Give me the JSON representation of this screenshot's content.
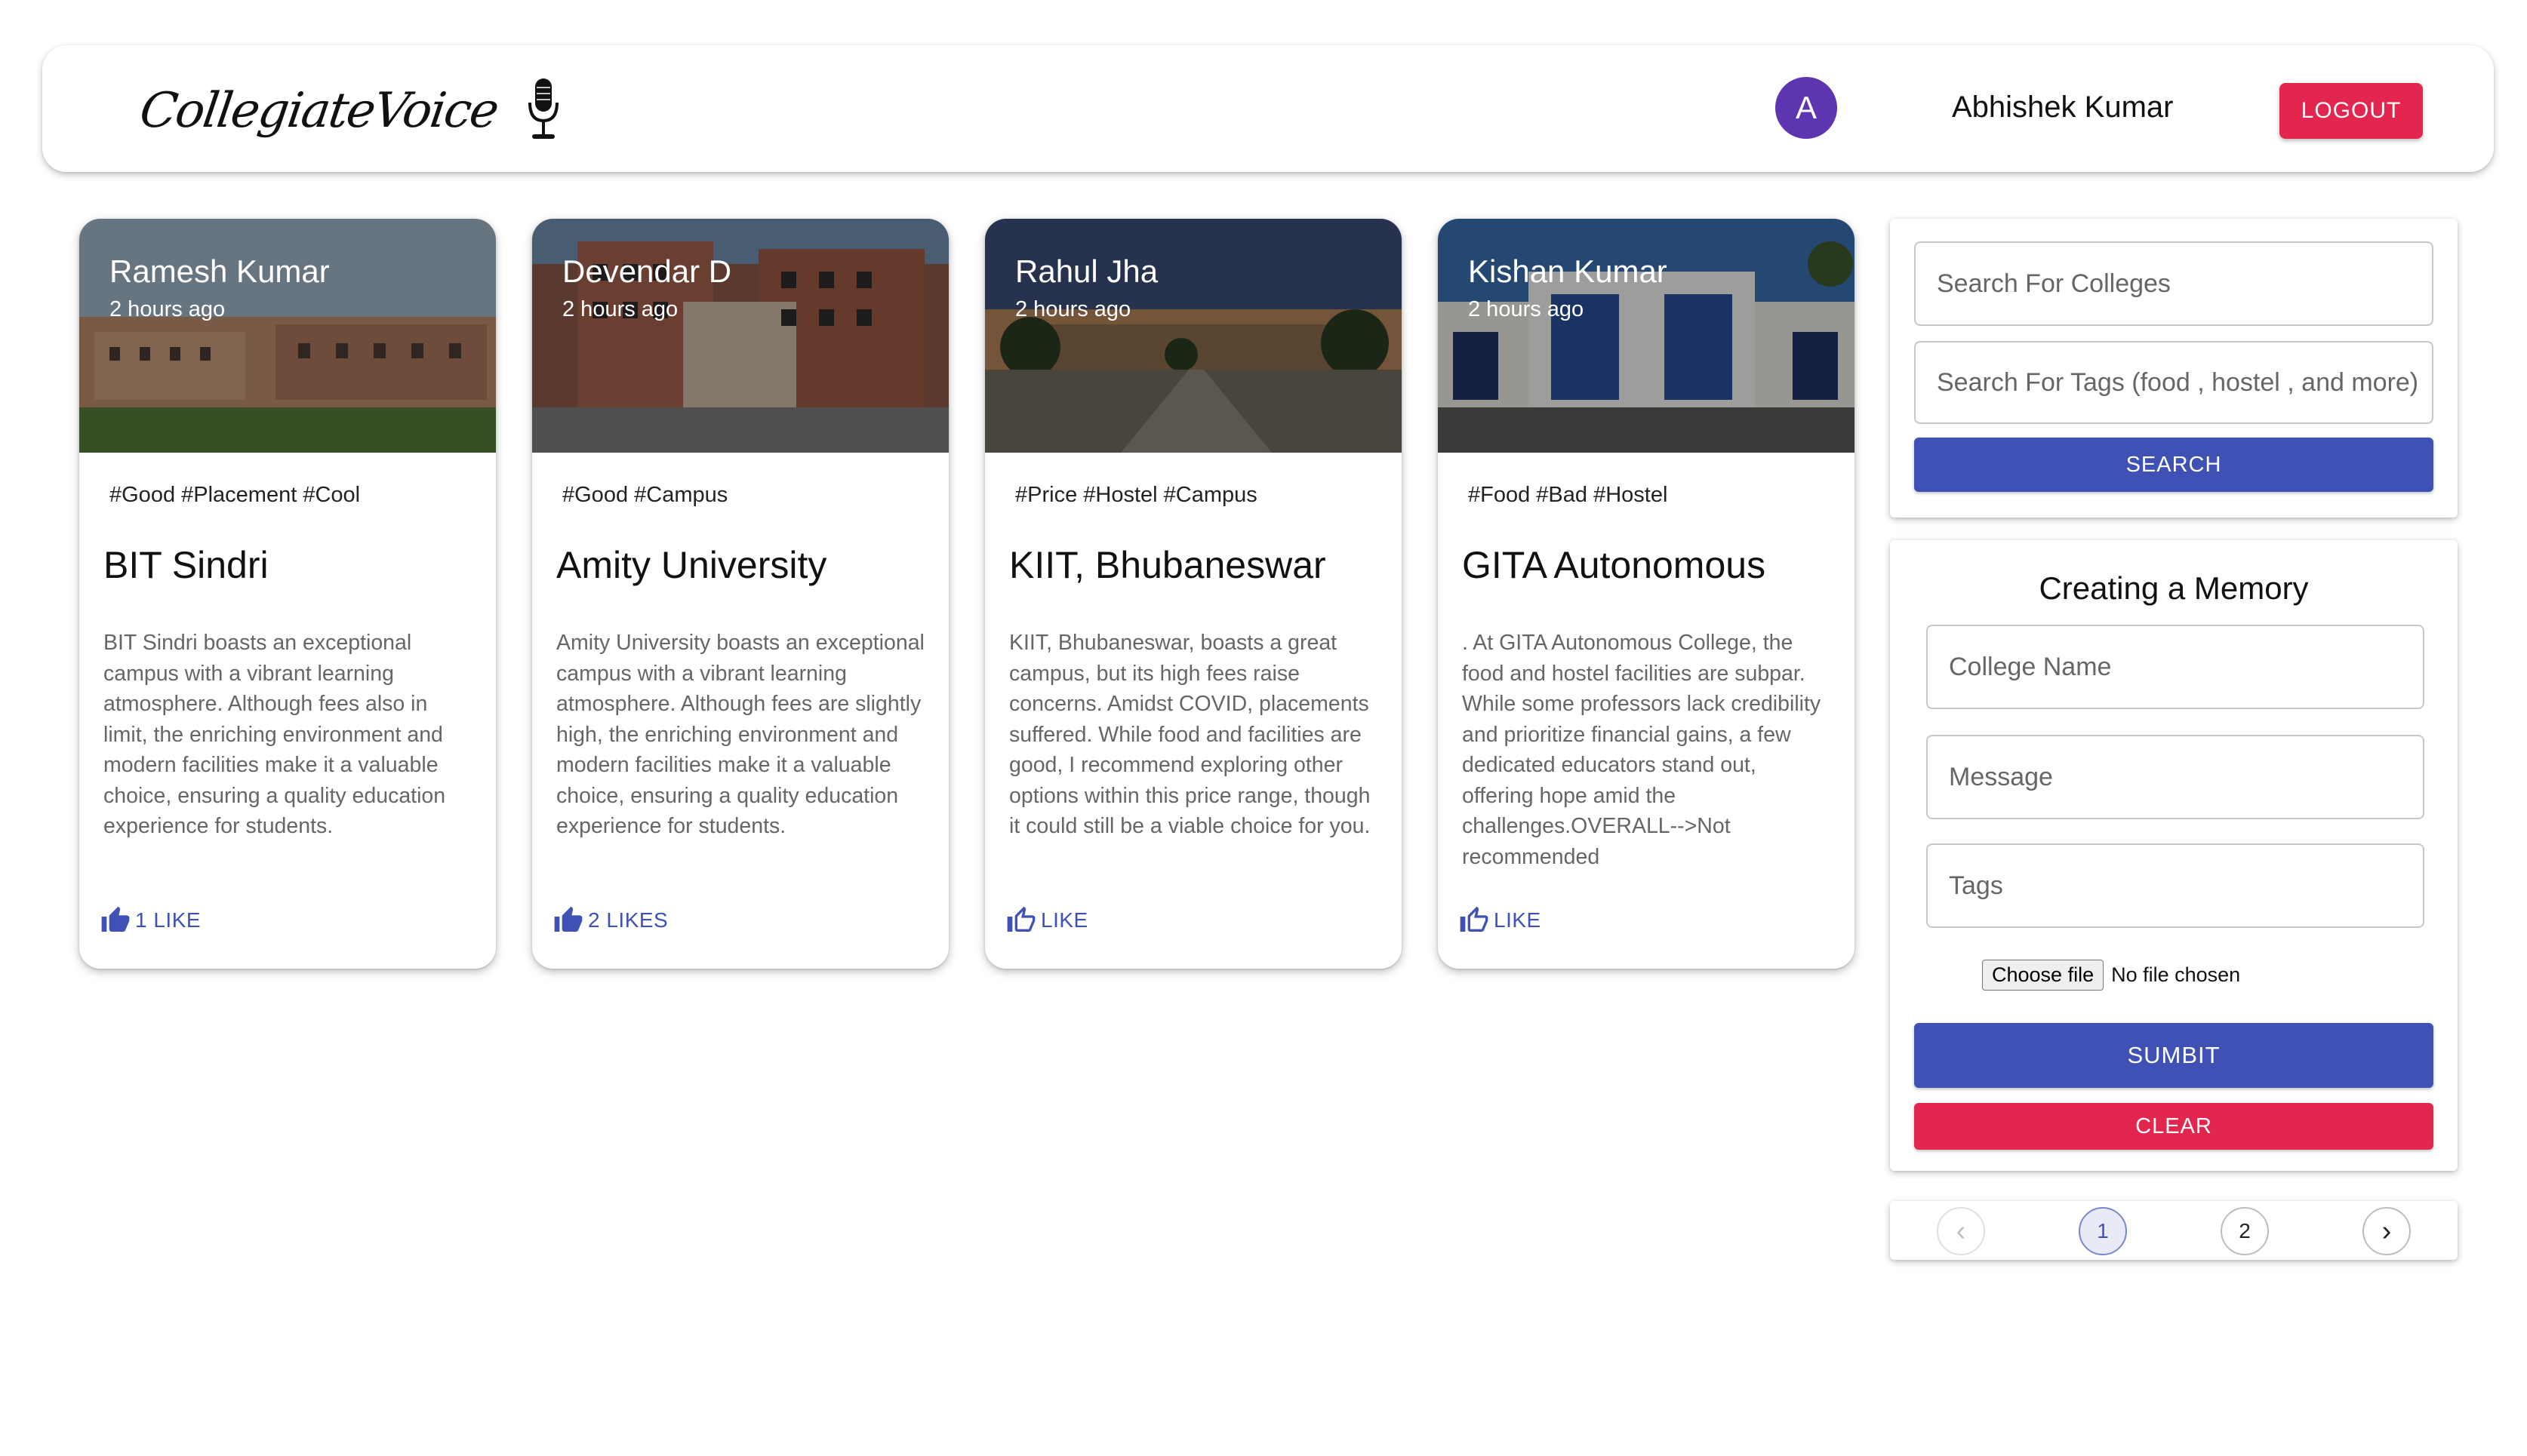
{
  "header": {
    "brand": "CollegiateVoice",
    "avatar_letter": "A",
    "user_name": "Abhishek Kumar",
    "logout_label": "LOGOUT"
  },
  "posts": [
    {
      "author": "Ramesh Kumar",
      "time": "2 hours ago",
      "tags": "#Good #Placement #Cool",
      "college": "BIT Sindri",
      "message": "BIT Sindri boasts an exceptional campus with a vibrant learning atmosphere. Although fees also in limit, the enriching environment and modern facilities make it a valuable choice, ensuring a quality education experience for students.",
      "like_label": "1 LIKE"
    },
    {
      "author": "Devendar D",
      "time": "2 hours ago",
      "tags": "#Good #Campus",
      "college": "Amity University",
      "message": "Amity University boasts an exceptional campus with a vibrant learning atmosphere. Although fees are slightly high, the enriching environment and modern facilities make it a valuable choice, ensuring a quality education experience for students.",
      "like_label": "2 LIKES"
    },
    {
      "author": "Rahul Jha",
      "time": "2 hours ago",
      "tags": "#Price #Hostel #Campus",
      "college": "KIIT, Bhubaneswar",
      "message": "KIIT, Bhubaneswar, boasts a great campus, but its high fees raise concerns. Amidst COVID, placements suffered. While food and facilities are good, I recommend exploring other options within this price range, though it could still be a viable choice for you.",
      "like_label": "LIKE"
    },
    {
      "author": "Kishan Kumar",
      "time": "2 hours ago",
      "tags": "#Food #Bad #Hostel",
      "college": "GITA Autonomous",
      "message": ". At GITA Autonomous College, the food and hostel facilities are subpar. While some professors lack credibility and prioritize financial gains, a few dedicated educators stand out, offering hope amid the challenges.OVERALL-->Not recommended",
      "like_label": "LIKE"
    }
  ],
  "search": {
    "colleges_placeholder": "Search For Colleges",
    "tags_placeholder": "Search For Tags (food , hostel , and more)",
    "button_label": "SEARCH"
  },
  "form": {
    "title": "Creating a Memory",
    "college_placeholder": "College Name",
    "message_placeholder": "Message",
    "tags_placeholder": "Tags",
    "file_button": "Choose file",
    "file_status": "No file chosen",
    "submit_label": "SUMBIT",
    "clear_label": "CLEAR"
  },
  "pagination": {
    "prev_icon": "‹",
    "pages": [
      "1",
      "2"
    ],
    "current": "1",
    "next_icon": "›"
  },
  "colors": {
    "primary": "#3f51b5",
    "secondary": "#e3264e",
    "avatar": "#5e35b1"
  }
}
